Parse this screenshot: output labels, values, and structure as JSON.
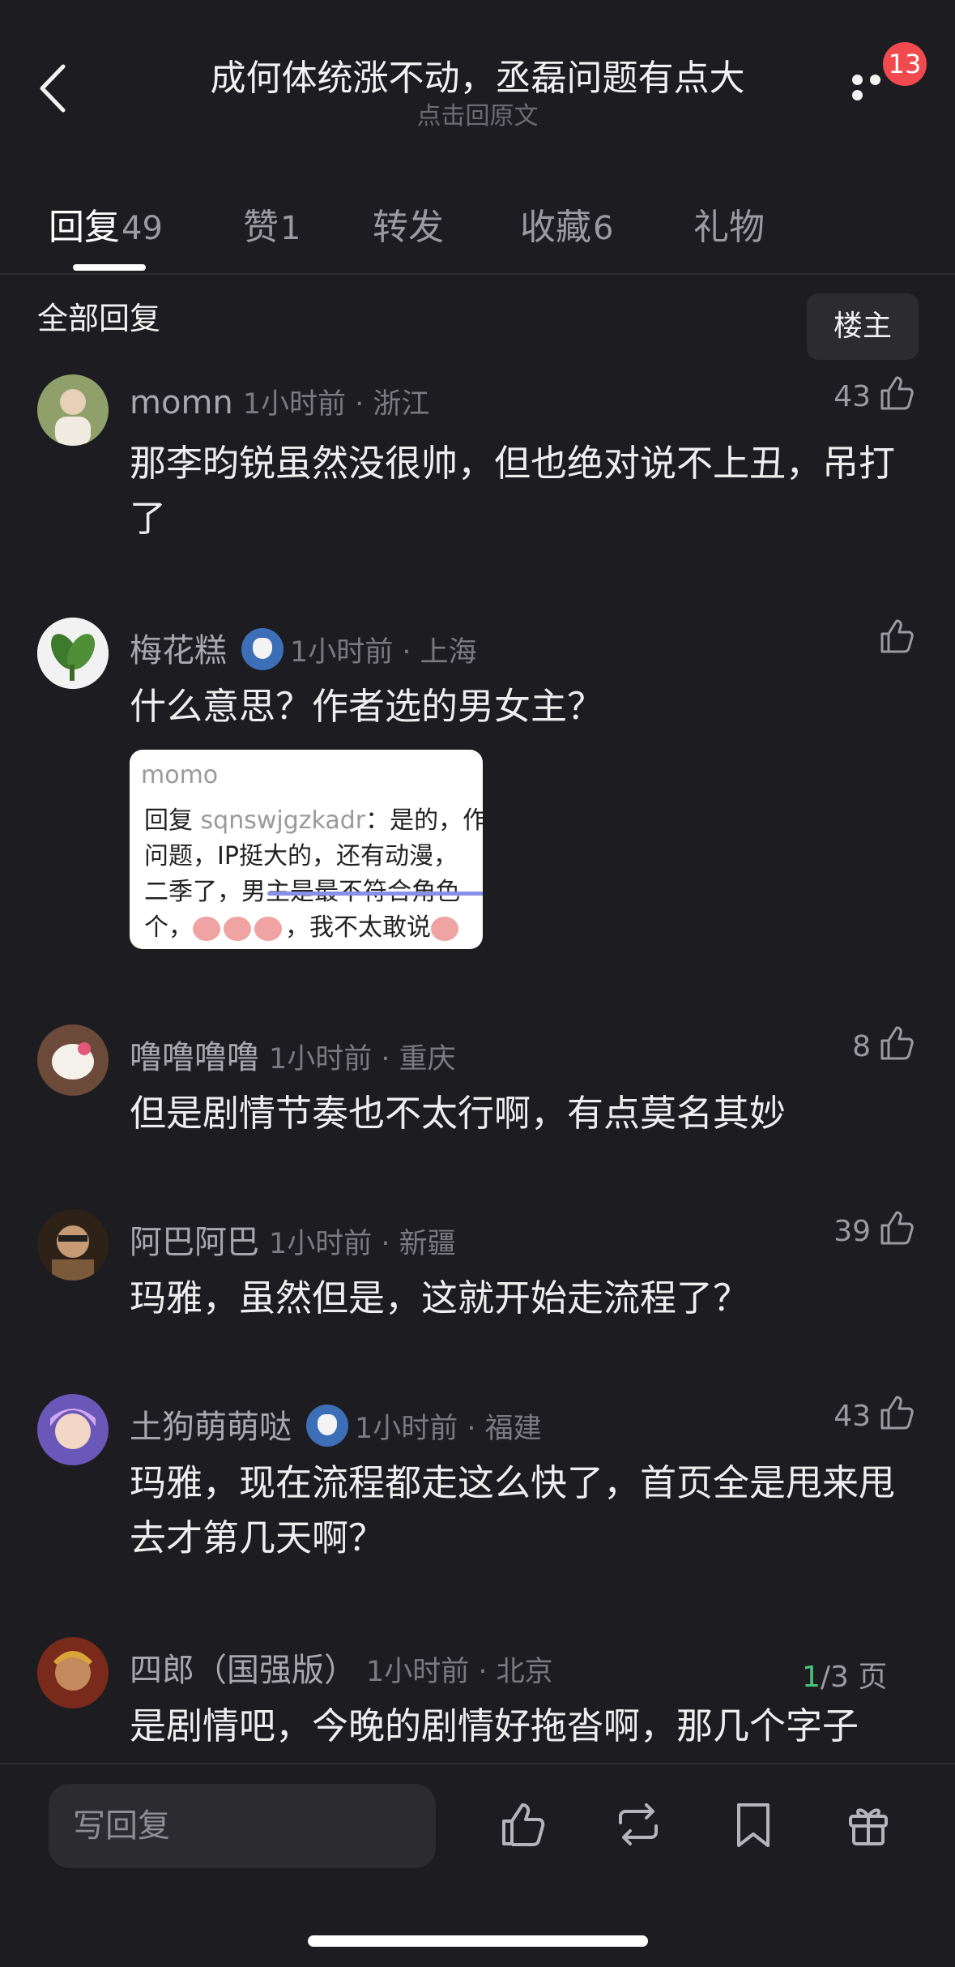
{
  "header": {
    "title": "成何体统涨不动，丞磊问题有点大",
    "subtitle": "点击回原文",
    "notification_count": "13"
  },
  "tabs": [
    {
      "label": "回复",
      "count": "49",
      "active": true
    },
    {
      "label": "赞",
      "count": "1"
    },
    {
      "label": "转发",
      "count": ""
    },
    {
      "label": "收藏",
      "count": "6"
    },
    {
      "label": "礼物",
      "count": ""
    }
  ],
  "section": {
    "title": "全部回复",
    "owner_button": "楼主"
  },
  "comments": [
    {
      "name": "momn",
      "time": "1小时前 · 浙江",
      "likes": "43",
      "text": "那李昀锐虽然没很帅，但也绝对说不上丑，吊打了"
    },
    {
      "name": "梅花糕",
      "time": "1小时前 · 上海",
      "likes": "",
      "text": "什么意思？作者选的男女主？"
    },
    {
      "name": "噜噜噜噜",
      "time": "1小时前 · 重庆",
      "likes": "8",
      "text": "但是剧情节奏也不太行啊，有点莫名其妙"
    },
    {
      "name": "阿巴阿巴",
      "time": "1小时前 · 新疆",
      "likes": "39",
      "text": "玛雅，虽然但是，这就开始走流程了？"
    },
    {
      "name": "土狗萌萌哒",
      "time": "1小时前 · 福建",
      "likes": "43",
      "text": "玛雅，现在流程都走这么快了，首页全是甩来甩去才第几天啊？"
    },
    {
      "name": "四郎（国强版）",
      "time": "1小时前 · 北京",
      "likes": "",
      "text": "是剧情吧，今晚的剧情好拖沓啊，那几个字子"
    }
  ],
  "quote": {
    "name": "momo",
    "line1_prefix": "回复 ",
    "line1_handle": "sqnswjgzkadr",
    "line1_text": "：是的，作",
    "line2": "问题，IP挺大的，还有动漫，",
    "line3": "二季了，男主是最不符合角色",
    "line4_a": "个，",
    "line4_b": "，我不太敢说"
  },
  "pager": {
    "current": "1",
    "rest": "/3 页"
  },
  "bottom": {
    "reply_placeholder": "写回复"
  },
  "colors": {
    "background": "#1d1d21",
    "badge": "#f04a4f",
    "pager_current": "#48c479"
  }
}
